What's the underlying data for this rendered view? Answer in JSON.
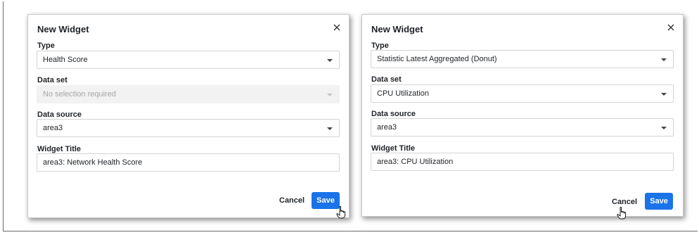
{
  "left_dialog": {
    "title": "New Widget",
    "type_label": "Type",
    "type_value": "Health Score",
    "dataset_label": "Data set",
    "dataset_placeholder": "No selection required",
    "datasource_label": "Data source",
    "datasource_value": "area3",
    "widget_title_label": "Widget Title",
    "widget_title_value": "area3: Network Health Score",
    "cancel_label": "Cancel",
    "save_label": "Save"
  },
  "right_dialog": {
    "title": "New Widget",
    "type_label": "Type",
    "type_value": "Statistic Latest Aggregated (Donut)",
    "dataset_label": "Data set",
    "dataset_value": "CPU Utilization",
    "datasource_label": "Data source",
    "datasource_value": "area3",
    "widget_title_label": "Widget Title",
    "widget_title_value": "area3: CPU Utilization",
    "cancel_label": "Cancel",
    "save_label": "Save"
  },
  "colors": {
    "primary": "#1a73e8",
    "disabled_bg": "#f2f2f2"
  },
  "icons": {
    "close": "close-icon",
    "dropdown": "chevron-down-icon",
    "cursor": "hand-pointer-cursor"
  }
}
